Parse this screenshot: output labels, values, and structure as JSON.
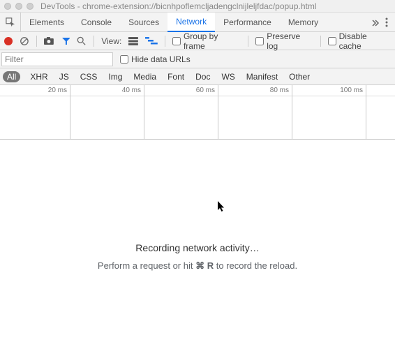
{
  "window": {
    "title": "DevTools - chrome-extension://bicnhpoflemcljadengclnijleljfdac/popup.html"
  },
  "tabs": {
    "items": [
      "Elements",
      "Console",
      "Sources",
      "Network",
      "Performance",
      "Memory"
    ],
    "selected": "Network"
  },
  "toolbar": {
    "view_label": "View:",
    "group_by_frame": "Group by frame",
    "preserve_log": "Preserve log",
    "disable_cache": "Disable cache"
  },
  "filterbar": {
    "filter_placeholder": "Filter",
    "hide_data_urls": "Hide data URLs"
  },
  "types": {
    "items": [
      "All",
      "XHR",
      "JS",
      "CSS",
      "Img",
      "Media",
      "Font",
      "Doc",
      "WS",
      "Manifest",
      "Other"
    ],
    "selected": "All"
  },
  "timeline": {
    "ticks": [
      "20 ms",
      "40 ms",
      "60 ms",
      "80 ms",
      "100 ms"
    ]
  },
  "empty": {
    "title": "Recording network activity…",
    "sub_prefix": "Perform a request or hit ",
    "shortcut": "⌘ R",
    "sub_suffix": " to record the reload."
  }
}
